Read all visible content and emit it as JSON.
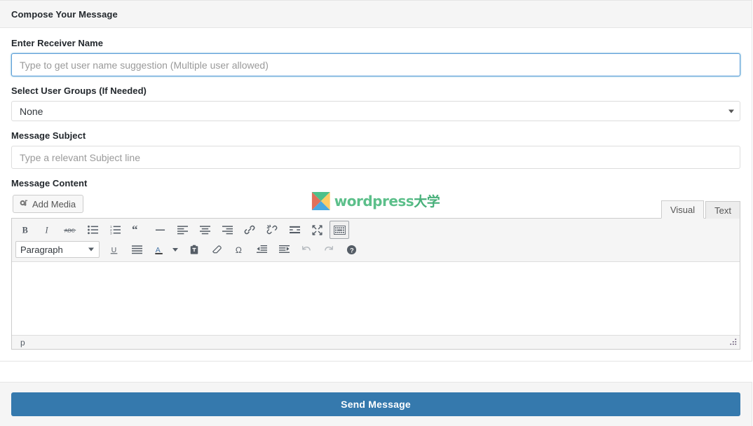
{
  "panel": {
    "header_title": "Compose Your Message"
  },
  "form": {
    "receiver": {
      "label": "Enter Receiver Name",
      "value": "",
      "placeholder": "Type to get user name suggestion (Multiple user allowed)"
    },
    "groups": {
      "label": "Select User Groups (If Needed)",
      "selected": "None",
      "options": [
        "None"
      ]
    },
    "subject": {
      "label": "Message Subject",
      "value": "",
      "placeholder": "Type a relevant Subject line"
    },
    "content": {
      "label": "Message Content",
      "body_value": ""
    }
  },
  "editor": {
    "add_media_label": "Add Media",
    "add_media_icon": "media-icon",
    "tabs": [
      {
        "label": "Visual",
        "active": true
      },
      {
        "label": "Text",
        "active": false
      }
    ],
    "format_select": {
      "selected": "Paragraph",
      "options": [
        "Paragraph"
      ]
    },
    "toolbar_row1": [
      {
        "name": "bold-icon",
        "title": "Bold",
        "active": false
      },
      {
        "name": "italic-icon",
        "title": "Italic",
        "active": false
      },
      {
        "name": "strikethrough-icon",
        "title": "Strikethrough",
        "active": false
      },
      {
        "name": "bulleted-list-icon",
        "title": "Bulleted list",
        "active": false
      },
      {
        "name": "numbered-list-icon",
        "title": "Numbered list",
        "active": false
      },
      {
        "name": "blockquote-icon",
        "title": "Blockquote",
        "active": false
      },
      {
        "name": "horizontal-rule-icon",
        "title": "Horizontal line",
        "active": false
      },
      {
        "name": "align-left-icon",
        "title": "Align left",
        "active": false
      },
      {
        "name": "align-center-icon",
        "title": "Align center",
        "active": false
      },
      {
        "name": "align-right-icon",
        "title": "Align right",
        "active": false
      },
      {
        "name": "link-icon",
        "title": "Insert/edit link",
        "active": false
      },
      {
        "name": "unlink-icon",
        "title": "Remove link",
        "active": false
      },
      {
        "name": "read-more-icon",
        "title": "Insert Read More tag",
        "active": false
      },
      {
        "name": "fullscreen-icon",
        "title": "Distraction-free writing mode",
        "active": false
      },
      {
        "name": "toolbar-toggle-icon",
        "title": "Toolbar Toggle",
        "active": true
      }
    ],
    "toolbar_row2": [
      {
        "name": "underline-icon",
        "title": "Underline",
        "active": false
      },
      {
        "name": "justify-icon",
        "title": "Justify",
        "active": false
      },
      {
        "name": "text-color-icon",
        "title": "Text color",
        "active": false
      },
      {
        "name": "paste-as-text-icon",
        "title": "Paste as text",
        "active": false
      },
      {
        "name": "clear-formatting-icon",
        "title": "Clear formatting",
        "active": false
      },
      {
        "name": "special-character-icon",
        "title": "Special character",
        "active": false
      },
      {
        "name": "outdent-icon",
        "title": "Decrease indent",
        "active": false
      },
      {
        "name": "indent-icon",
        "title": "Increase indent",
        "active": false
      },
      {
        "name": "undo-icon",
        "title": "Undo",
        "active": false
      },
      {
        "name": "redo-icon",
        "title": "Redo",
        "active": false
      },
      {
        "name": "help-icon",
        "title": "Keyboard Shortcuts",
        "active": false
      }
    ],
    "status_path": "p",
    "resize_handle": "resize-grip"
  },
  "watermark": {
    "text": "wordpress",
    "cjk": "大学",
    "mark_colors": {
      "top": "#4ec08a",
      "left": "#e0705a",
      "right": "#ffcc66",
      "bottom": "#4aa8e0"
    },
    "text_color": "#5cbf8a"
  },
  "footer": {
    "send_label": "Send Message",
    "send_color": "#3579ad"
  }
}
